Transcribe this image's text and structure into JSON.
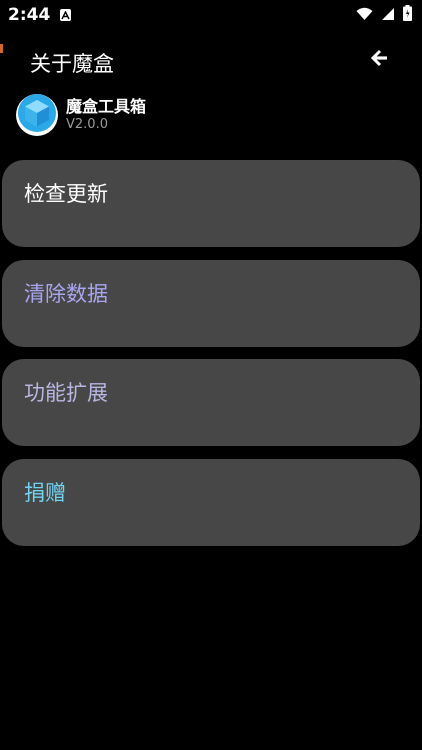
{
  "status_bar": {
    "time": "2:44",
    "icons": [
      "notification-a-icon",
      "wifi-icon",
      "signal-icon",
      "battery-icon"
    ]
  },
  "header": {
    "title": "关于魔盒",
    "back_icon": "arrow-left-icon"
  },
  "app": {
    "name": "魔盒工具箱",
    "version": "V2.0.0",
    "logo_icon": "cube-logo-icon"
  },
  "menu": {
    "items": [
      {
        "label": "检查更新",
        "color": "#ffffff"
      },
      {
        "label": "清除数据",
        "color": "#a9a6f0"
      },
      {
        "label": "功能扩展",
        "color": "#b9b6e2"
      },
      {
        "label": "捐赠",
        "color": "#6fd3f2"
      }
    ]
  },
  "colors": {
    "background": "#000000",
    "card": "#474747",
    "accent_edge": "#d4652a"
  }
}
